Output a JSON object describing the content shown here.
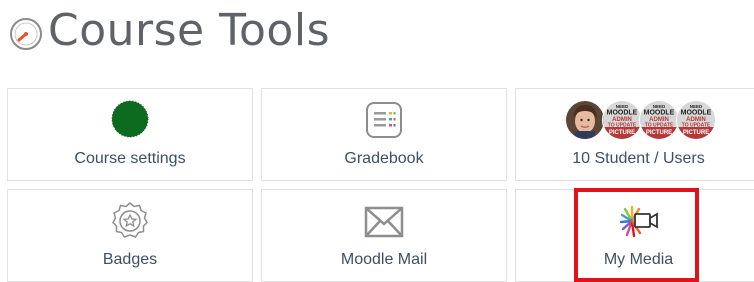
{
  "page": {
    "title": "Course Tools",
    "icon": "gauge-icon",
    "accent": "#e8542a"
  },
  "tiles": [
    {
      "label": "Course settings",
      "icon": "green-circle-icon",
      "icon_color": "#0d6b1f"
    },
    {
      "label": "Gradebook",
      "icon": "gradebook-icon"
    },
    {
      "label": "10 Student / Users",
      "icon": "user-avatars",
      "avatar_placeholder_lines": [
        "NEED",
        "MOODLE",
        "ADMIN",
        "TO UPDATE",
        "PICTURE"
      ]
    },
    {
      "label": "Badges",
      "icon": "badge-icon"
    },
    {
      "label": "Moodle Mail",
      "icon": "mail-envelope-icon"
    },
    {
      "label": "My Media",
      "icon": "video-camera-icon",
      "highlighted": true,
      "highlight_color": "#e0121b"
    }
  ]
}
